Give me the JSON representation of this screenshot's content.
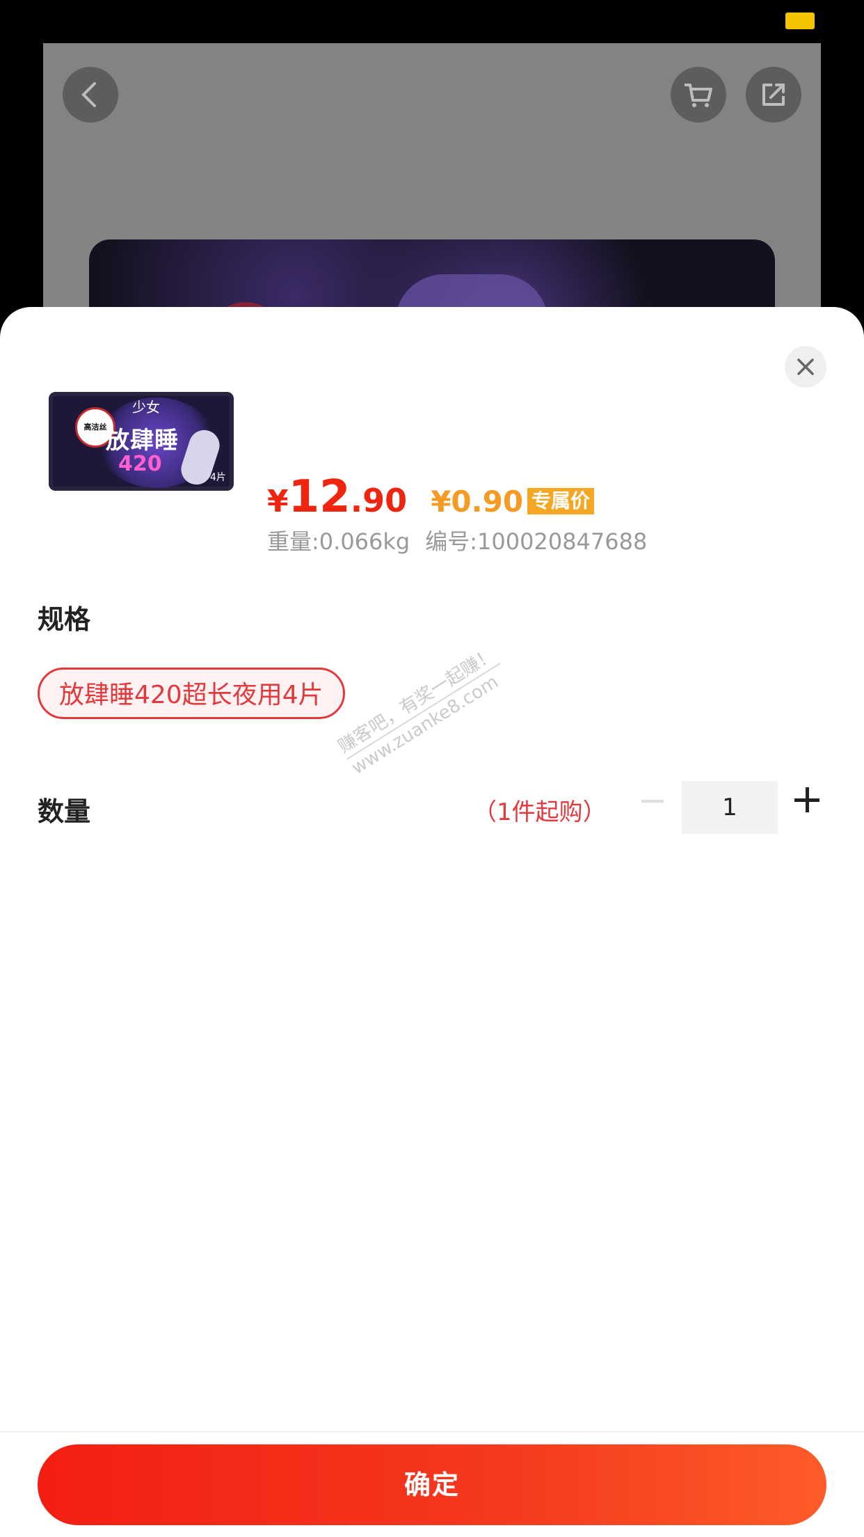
{
  "background_page": {
    "back_icon": "chevron-left-icon",
    "cart_icon": "cart-icon",
    "share_icon": "share-icon"
  },
  "sheet": {
    "close_icon": "close-icon",
    "product": {
      "thumbnail_text": {
        "badge": "高洁丝",
        "brand": "少女",
        "line1": "放肆睡",
        "line2": "420",
        "count": "4片"
      },
      "price": {
        "currency": "¥",
        "integer": "12",
        "decimal": ".90"
      },
      "vip_price": "¥0.90",
      "vip_tag": "专属价",
      "weight": "重量:0.066kg",
      "sku": "编号:100020847688"
    },
    "spec": {
      "title": "规格",
      "selected_option": "放肆睡420超长夜用4片"
    },
    "quantity": {
      "title": "数量",
      "note": "（1件起购）",
      "value": "1"
    },
    "watermark": {
      "line1": "赚客吧，有奖一起赚！",
      "line2": "www.zuanke8.com"
    },
    "confirm_label": "确定"
  },
  "colors": {
    "accent_red": "#f0250f",
    "vip_orange": "#f59a23",
    "chip_border": "#e4393c"
  }
}
